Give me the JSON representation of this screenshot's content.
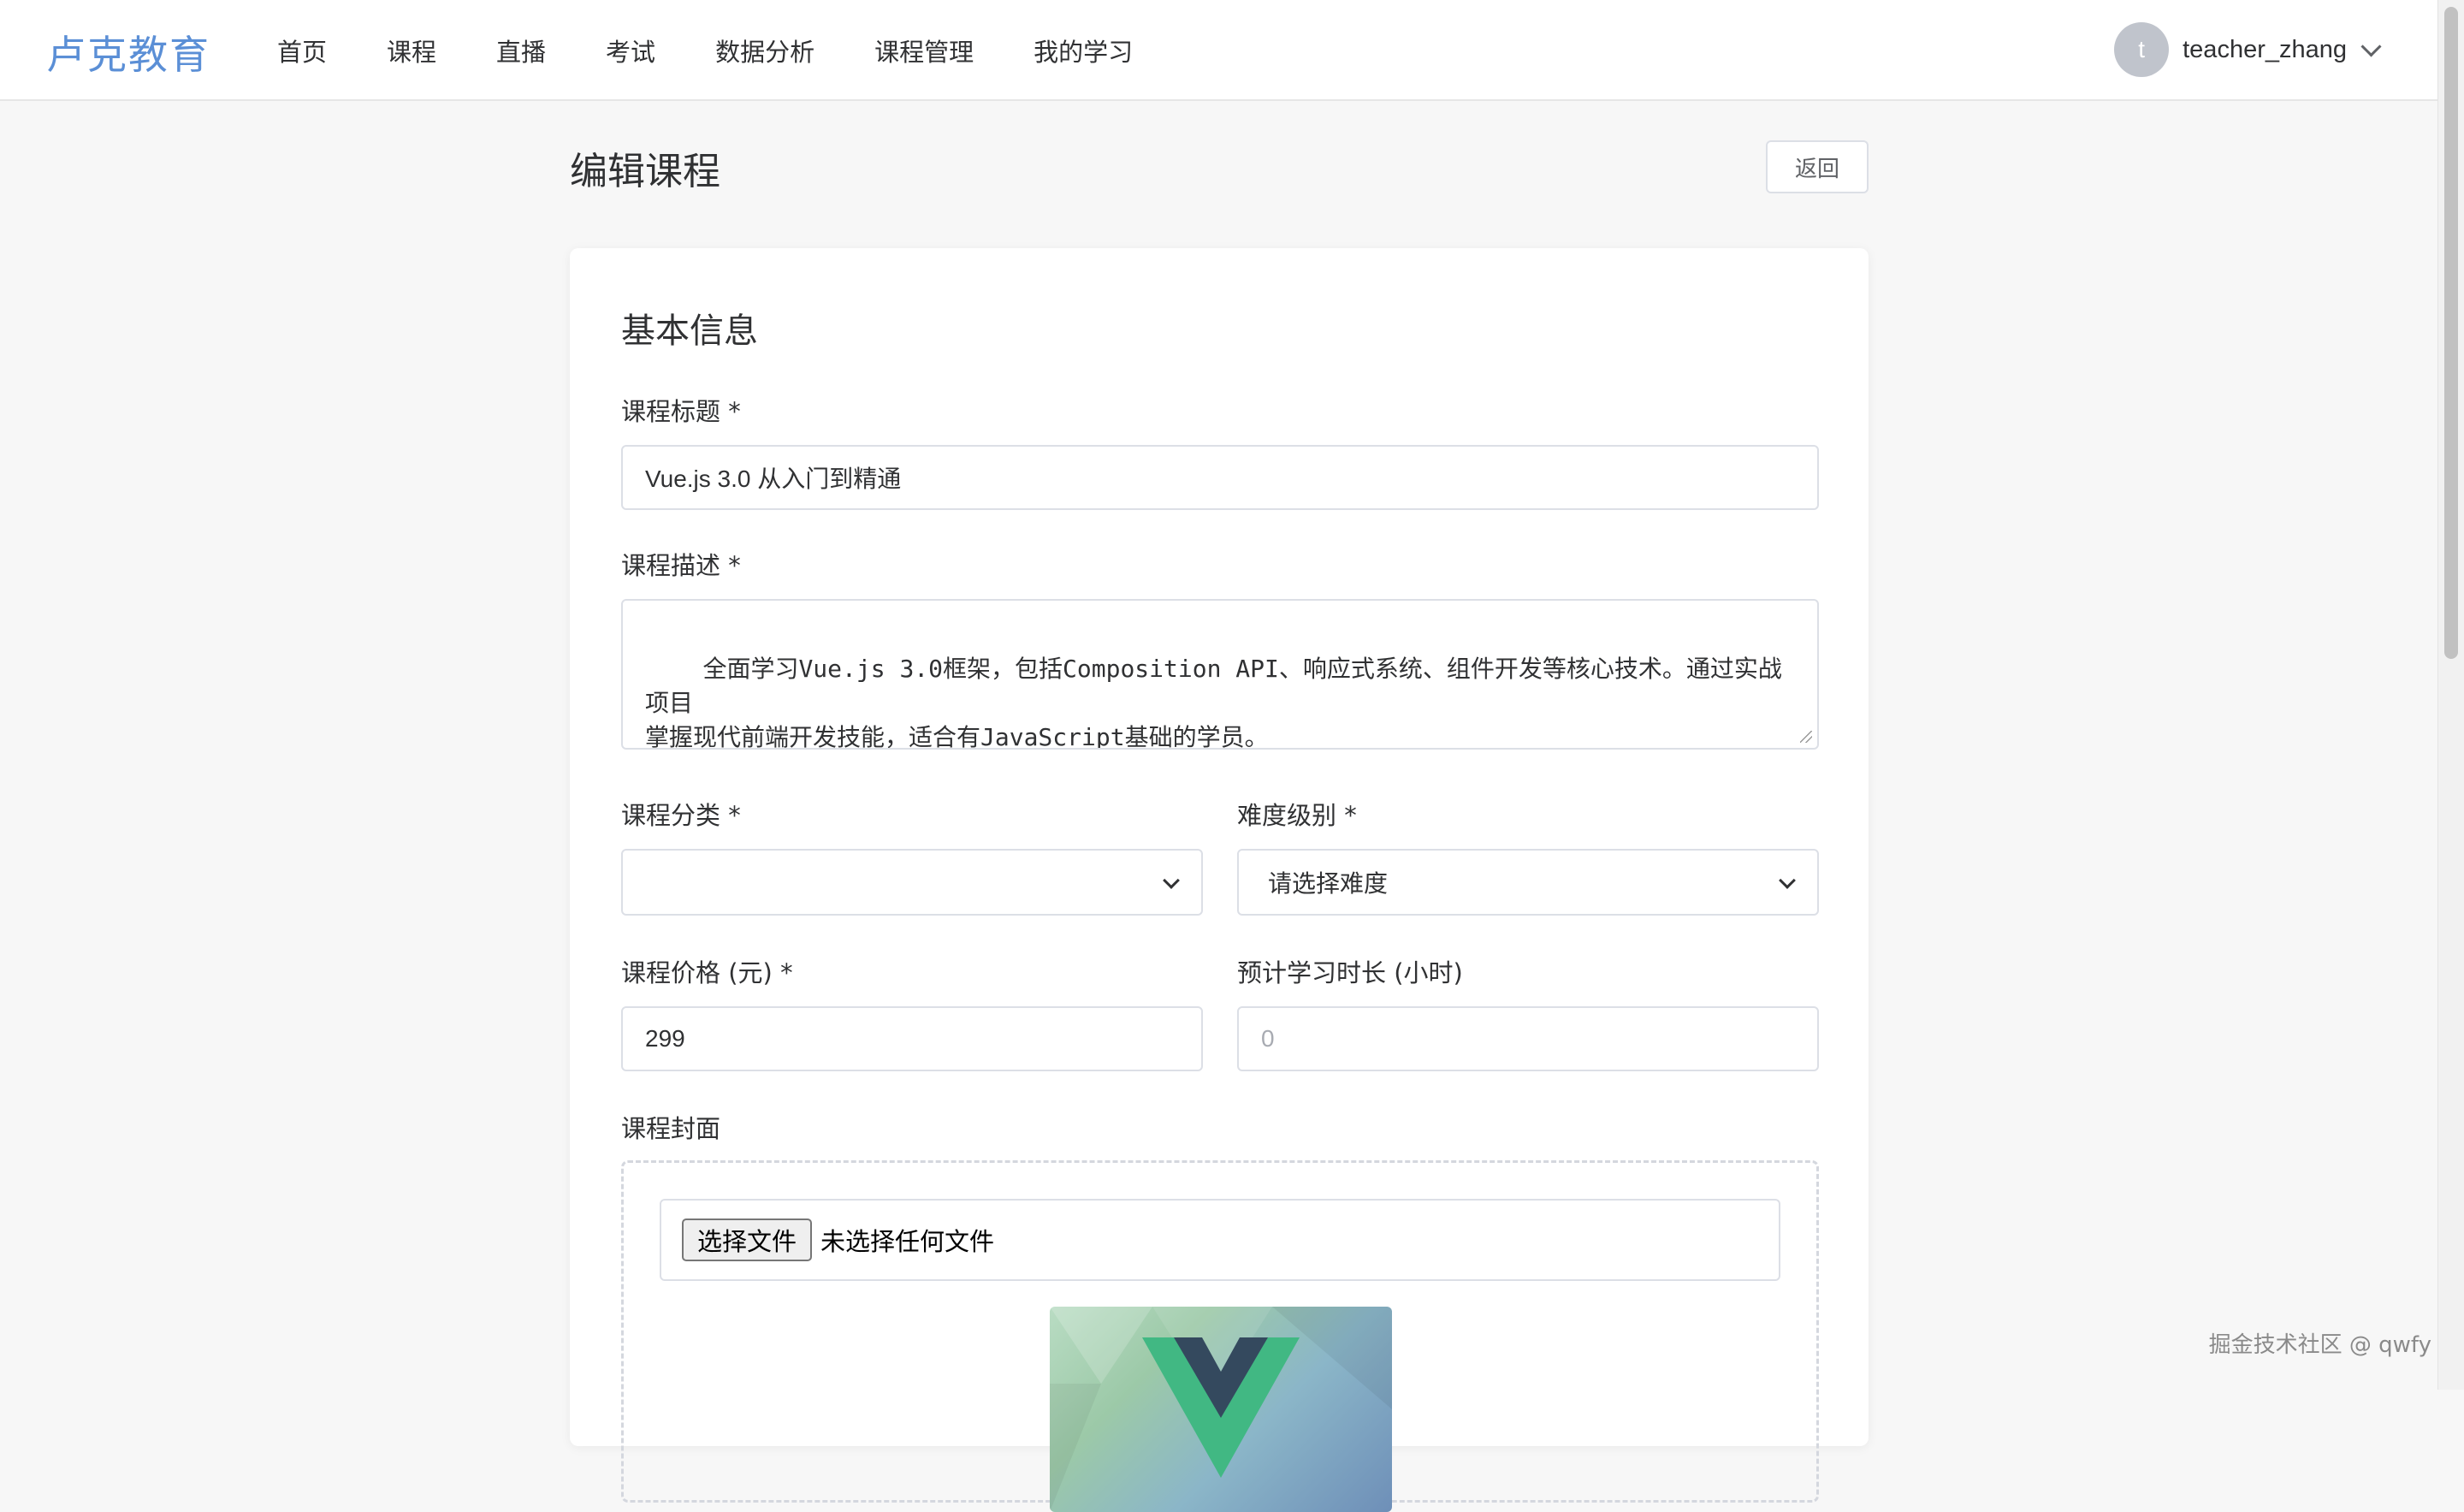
{
  "header": {
    "logo": "卢克教育",
    "nav": [
      "首页",
      "课程",
      "直播",
      "考试",
      "数据分析",
      "课程管理",
      "我的学习"
    ],
    "user": {
      "avatar_initial": "t",
      "name": "teacher_zhang"
    }
  },
  "page": {
    "title": "编辑课程",
    "back_label": "返回"
  },
  "form": {
    "section_title": "基本信息",
    "title_label": "课程标题 *",
    "title_value": "Vue.js 3.0 从入门到精通",
    "desc_label": "课程描述 *",
    "desc_value": "全面学习Vue.js 3.0框架，包括Composition API、响应式系统、组件开发等核心技术。通过实战项目\n掌握现代前端开发技能，适合有JavaScript基础的学员。",
    "category_label": "课程分类 *",
    "category_value": "",
    "difficulty_label": "难度级别 *",
    "difficulty_value": "请选择难度",
    "price_label": "课程价格 (元) *",
    "price_value": "299",
    "duration_label": "预计学习时长 (小时)",
    "duration_placeholder": "0",
    "cover_label": "课程封面",
    "file_button": "选择文件",
    "file_status": "未选择任何文件"
  },
  "watermark": "掘金技术社区 @ qwfy"
}
